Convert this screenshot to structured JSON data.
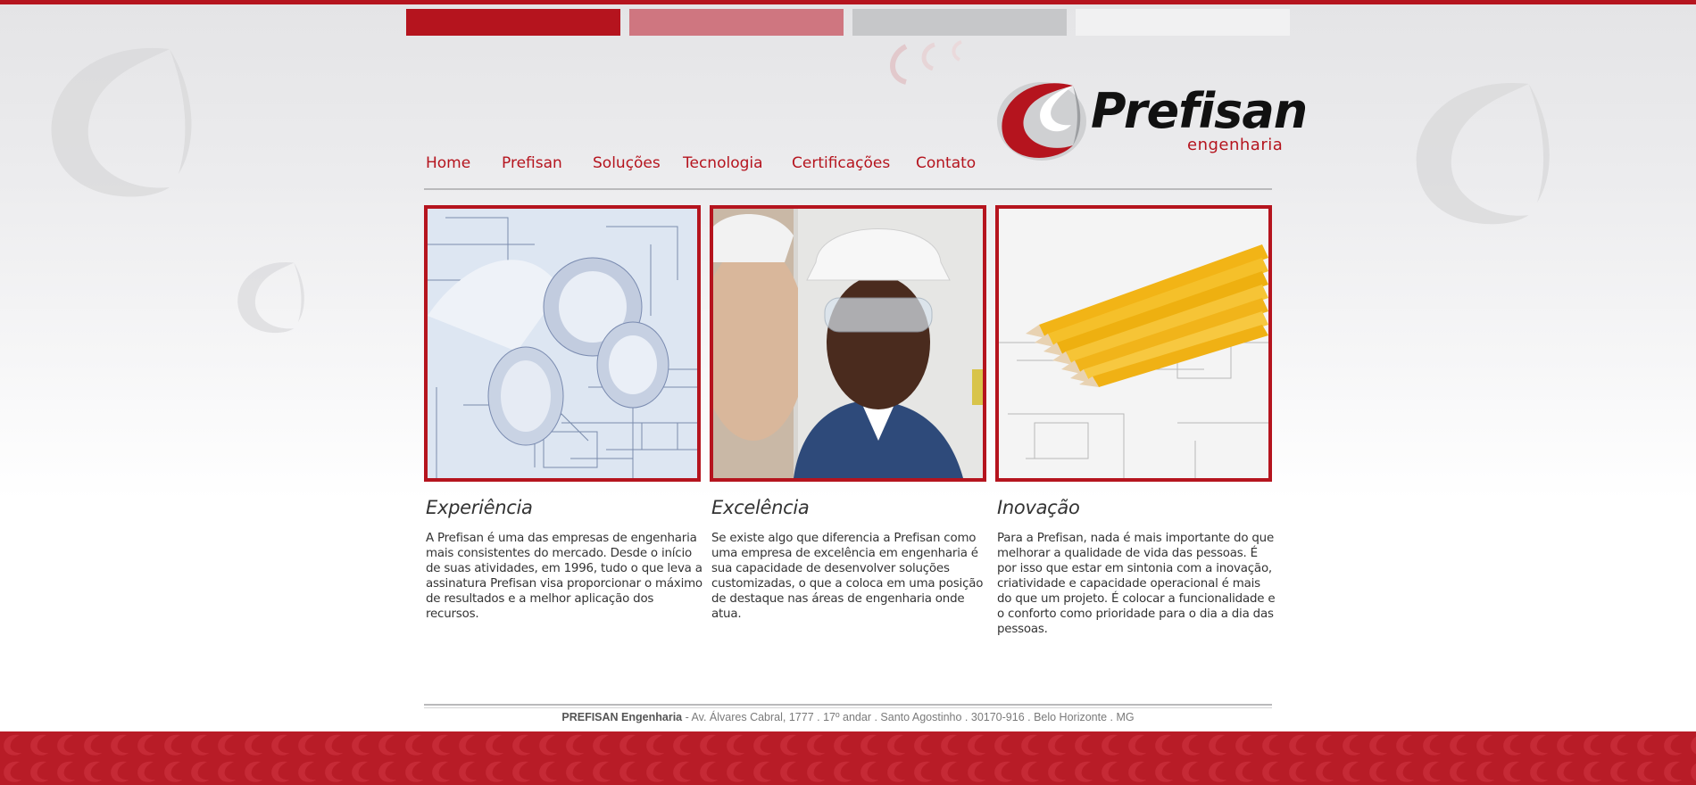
{
  "colors": {
    "brand_red": "#b5141e",
    "tab_pink": "#cf7680",
    "tab_grey": "#c6c7c9",
    "tab_light": "#f1f1f2",
    "footer_red": "#b81c27"
  },
  "logo": {
    "name": "Prefisan",
    "subtitle": "engenharia",
    "icon": "prefisan-swirl-logo-icon"
  },
  "nav": {
    "items": [
      {
        "label": "Home"
      },
      {
        "label": "Prefisan"
      },
      {
        "label": "Soluções"
      },
      {
        "label": "Tecnologia"
      },
      {
        "label": "Certificações"
      },
      {
        "label": "Contato"
      }
    ]
  },
  "features": [
    {
      "image": "blueprint-rolls-photo",
      "title": "Experiência",
      "text": "A Prefisan é uma das empresas de engenharia mais consistentes do mercado. Desde o início de suas atividades, em 1996, tudo o que leva a assinatura Prefisan visa proporcionar o máximo de resultados e a melhor aplicação dos recursos."
    },
    {
      "image": "engineer-hardhat-photo",
      "title": "Excelência",
      "text": "Se existe algo que diferencia a Prefisan como uma empresa de excelência em engenharia é sua capacidade de desenvolver soluções customizadas, o que a coloca em uma posição de destaque nas áreas de engenharia onde atua."
    },
    {
      "image": "pencils-on-drawing-photo",
      "title": "Inovação",
      "text": "Para a Prefisan, nada é mais importante do que melhorar a qualidade de vida das pessoas. É por isso que estar em sintonia com a inovação, criatividade e capacidade operacional é mais do que um projeto. É colocar a funcionalidade e o conforto como prioridade para o dia a dia das pessoas."
    }
  ],
  "footer": {
    "company": "PREFISAN Engenharia",
    "address": " - Av. Álvares Cabral, 1777 . 17º andar . Santo Agostinho . 30170-916 . Belo Horizonte . MG"
  }
}
